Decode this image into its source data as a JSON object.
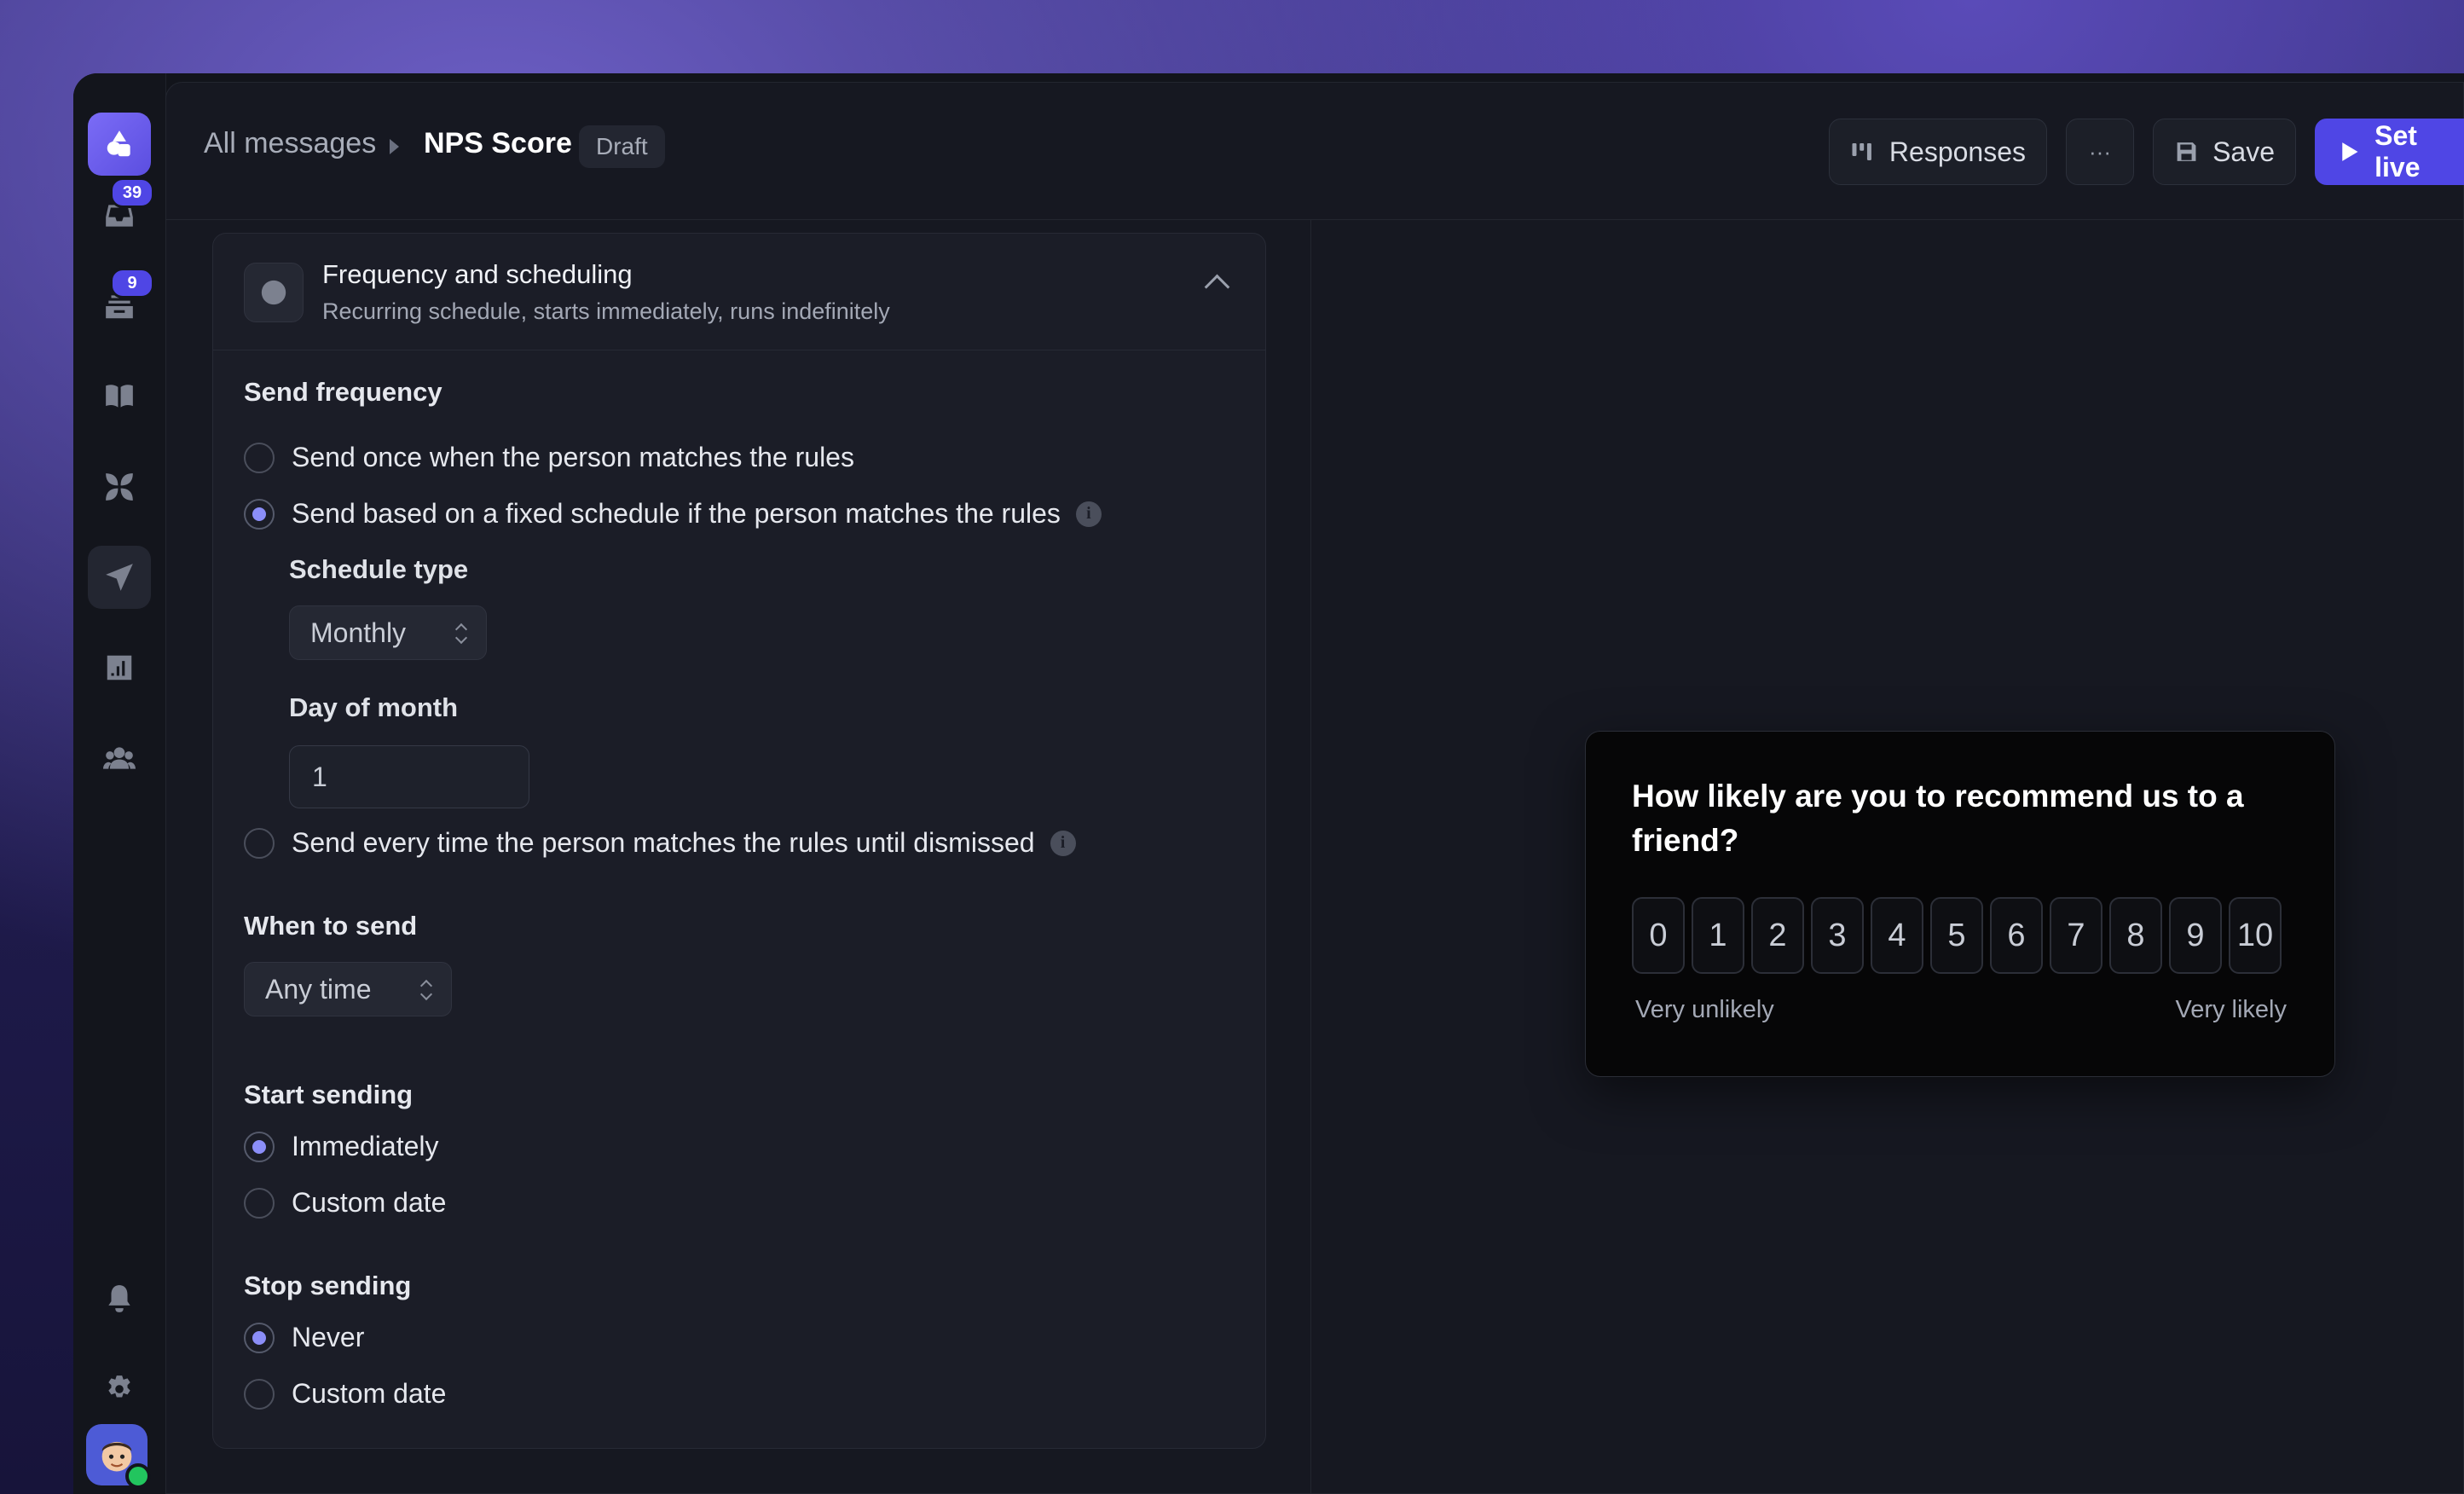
{
  "rail": {
    "inbox_badge": "39",
    "tickets_badge": "9"
  },
  "header": {
    "breadcrumb_root": "All messages",
    "title": "NPS Score",
    "status": "Draft",
    "responses_label": "Responses",
    "more_label": "···",
    "save_label": "Save",
    "set_live_label": "Set live"
  },
  "section": {
    "title": "Frequency and scheduling",
    "subtitle": "Recurring schedule, starts immediately, runs indefinitely",
    "send_frequency_label": "Send frequency",
    "freq_options": [
      {
        "label": "Send once when the person matches the rules",
        "selected": false
      },
      {
        "label": "Send based on a fixed schedule if the person matches the rules",
        "selected": true
      },
      {
        "label": "Send every time the person matches the rules until dismissed",
        "selected": false
      }
    ],
    "schedule_type_label": "Schedule type",
    "schedule_type_value": "Monthly",
    "day_of_month_label": "Day of month",
    "day_of_month_value": "1",
    "when_to_send_label": "When to send",
    "when_to_send_value": "Any time",
    "start_sending_label": "Start sending",
    "start_options": [
      {
        "label": "Immediately",
        "selected": true
      },
      {
        "label": "Custom date",
        "selected": false
      }
    ],
    "stop_sending_label": "Stop sending",
    "stop_options": [
      {
        "label": "Never",
        "selected": true
      },
      {
        "label": "Custom date",
        "selected": false
      }
    ]
  },
  "preview": {
    "question": "How likely are you to recommend us to a friend?",
    "scale": [
      "0",
      "1",
      "2",
      "3",
      "4",
      "5",
      "6",
      "7",
      "8",
      "9",
      "10"
    ],
    "low_label": "Very unlikely",
    "high_label": "Very likely"
  }
}
